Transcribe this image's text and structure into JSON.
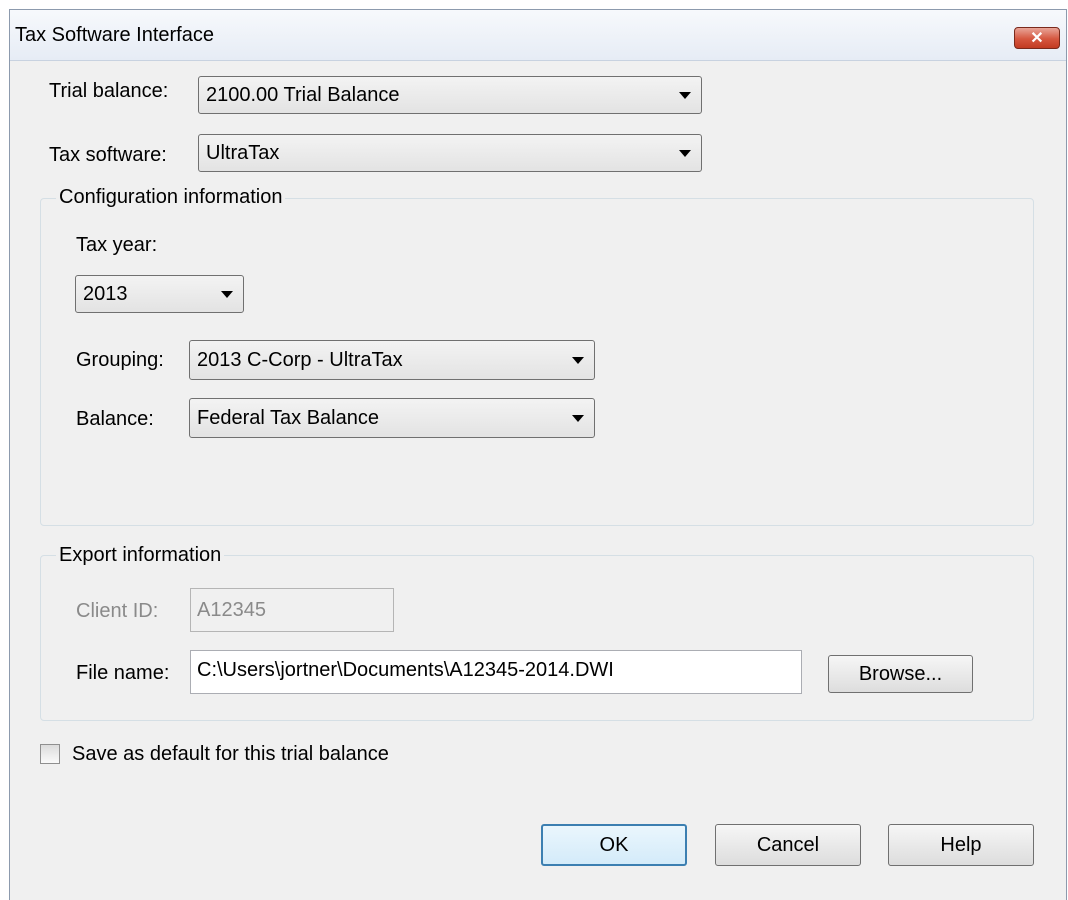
{
  "window": {
    "title": "Tax Software Interface",
    "close_icon": "close-icon"
  },
  "trial_balance": {
    "label": "Trial balance:",
    "value": "2100.00 Trial Balance"
  },
  "tax_software": {
    "label": "Tax software:",
    "value": "UltraTax"
  },
  "configuration": {
    "legend": "Configuration information",
    "tax_year_label": "Tax year:",
    "tax_year_value": "2013",
    "grouping_label": "Grouping:",
    "grouping_value": "2013 C-Corp - UltraTax",
    "balance_label": "Balance:",
    "balance_value": "Federal Tax Balance"
  },
  "export": {
    "legend": "Export information",
    "client_id_label": "Client ID:",
    "client_id_value": "A12345",
    "file_name_label": "File name:",
    "file_name_value": "C:\\Users\\jortner\\Documents\\A12345-2014.DWI",
    "browse_label": "Browse..."
  },
  "save_default": {
    "label": "Save as default for this trial balance",
    "checked": false
  },
  "buttons": {
    "ok": "OK",
    "cancel": "Cancel",
    "help": "Help"
  }
}
